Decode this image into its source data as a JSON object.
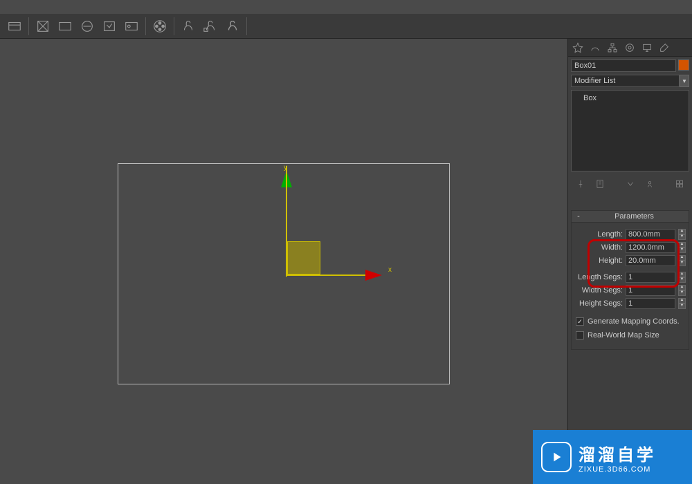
{
  "object": {
    "name": "Box01",
    "modifier_list_label": "Modifier List",
    "stack_item": "Box"
  },
  "rollout": {
    "title": "Parameters"
  },
  "params": {
    "length_label": "Length:",
    "length_value": "800.0mm",
    "width_label": "Width:",
    "width_value": "1200.0mm",
    "height_label": "Height:",
    "height_value": "20.0mm",
    "length_segs_label": "Length Segs:",
    "length_segs_value": "1",
    "width_segs_label": "Width Segs:",
    "width_segs_value": "1",
    "height_segs_label": "Height Segs:",
    "height_segs_value": "1",
    "gen_mapping": "Generate Mapping Coords.",
    "real_world": "Real-World Map Size"
  },
  "gizmo": {
    "x": "x",
    "y": "y"
  },
  "watermark": {
    "title": "溜溜自学",
    "sub": "ZIXUE.3D66.COM"
  }
}
